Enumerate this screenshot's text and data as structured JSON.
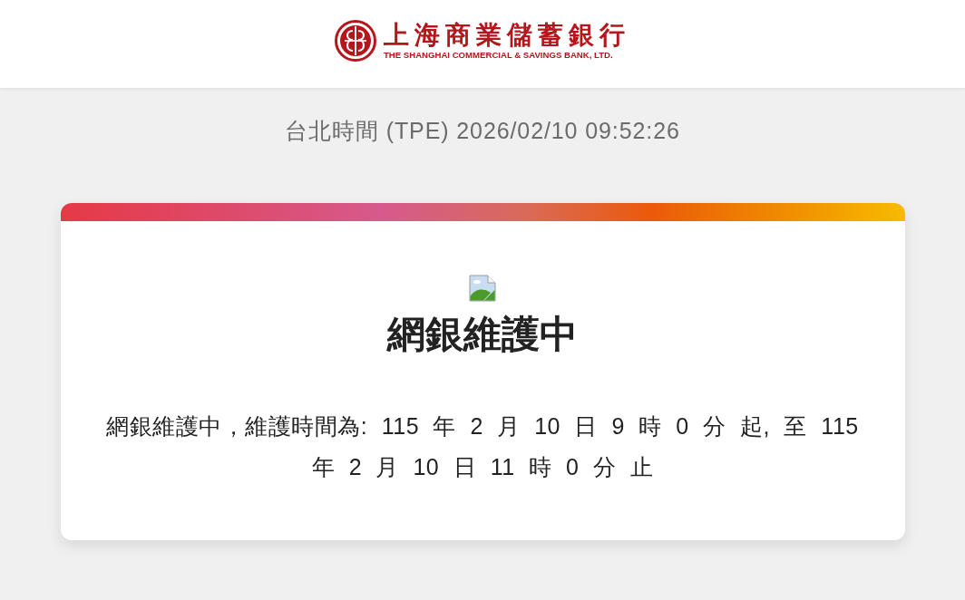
{
  "header": {
    "logo": {
      "name_zh": "上海商業儲蓄銀行",
      "name_en": "THE SHANGHAI COMMERCIAL & SAVINGS BANK, LTD."
    }
  },
  "clock": {
    "text": "台北時間 (TPE) 2026/02/10 09:52:26"
  },
  "notice": {
    "title": "網銀維護中",
    "message": "網銀維護中，維護時間為: 115 年 2 月 10 日 9 時 0 分 起, 至 115 年 2 月 10 日 11 時 0 分 止"
  }
}
